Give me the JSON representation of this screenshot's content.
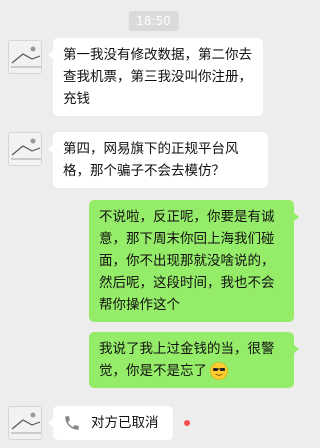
{
  "chat": {
    "timestamp": "18:50",
    "messages": [
      {
        "direction": "incoming",
        "text": "第一我没有修改数据，第二你去查我机票，第三我没叫你注册，充钱"
      },
      {
        "direction": "incoming",
        "text": "第四，网易旗下的正规平台风格，那个骗子不会去模仿？"
      },
      {
        "direction": "outgoing",
        "text": "不说啦，反正呢，你要是有诚意，那下周末你回上海我们碰面，你不出现那就没啥说的，然后呢，这段时间，我也不会帮你操作这个"
      },
      {
        "direction": "outgoing",
        "text": "我说了我上过金钱的当，很警觉，你是不是忘了",
        "emoji": "cool-sunglasses-emoji"
      },
      {
        "direction": "incoming",
        "type": "call",
        "text": "对方已取消",
        "icon": "phone-icon",
        "unread": true
      }
    ]
  },
  "colors": {
    "background": "#ededed",
    "incoming_bubble": "#ffffff",
    "outgoing_bubble": "#95ec69",
    "unread_dot": "#fa5151"
  }
}
